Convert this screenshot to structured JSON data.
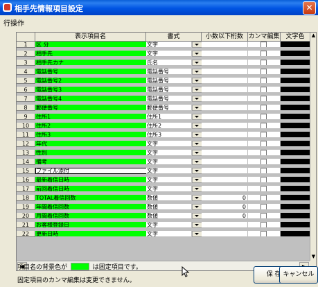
{
  "window": {
    "title": "相手先情報項目設定",
    "close_glyph": "✕"
  },
  "menu": {
    "items": [
      "行操作"
    ]
  },
  "grid": {
    "headers": {
      "row_number": "",
      "display_name": "表示項目名",
      "format": "書式",
      "decimals": "小数以下桁数",
      "comma": "カンマ編集",
      "text_color": "文字色"
    },
    "rows": [
      {
        "num": "1",
        "name": "区 分",
        "format": "文字",
        "decimals": ""
      },
      {
        "num": "2",
        "name": "相手先",
        "format": "文字",
        "decimals": ""
      },
      {
        "num": "3",
        "name": "相手先カナ",
        "format": "氏名",
        "decimals": ""
      },
      {
        "num": "4",
        "name": "電話番号",
        "format": "電話番号",
        "decimals": ""
      },
      {
        "num": "5",
        "name": "電話番号2",
        "format": "電話番号",
        "decimals": ""
      },
      {
        "num": "6",
        "name": "電話番号3",
        "format": "電話番号",
        "decimals": ""
      },
      {
        "num": "7",
        "name": "電話番号4",
        "format": "電話番号",
        "decimals": ""
      },
      {
        "num": "8",
        "name": "郵便番号",
        "format": "郵便番号",
        "decimals": ""
      },
      {
        "num": "9",
        "name": "住所1",
        "format": "住所1",
        "decimals": ""
      },
      {
        "num": "10",
        "name": "住所2",
        "format": "住所2",
        "decimals": ""
      },
      {
        "num": "11",
        "name": "住所3",
        "format": "住所3",
        "decimals": ""
      },
      {
        "num": "12",
        "name": "年代",
        "format": "文字",
        "decimals": ""
      },
      {
        "num": "13",
        "name": "性別",
        "format": "文字",
        "decimals": ""
      },
      {
        "num": "14",
        "name": "備考",
        "format": "文字",
        "decimals": ""
      },
      {
        "num": "15",
        "name": "ファイル添付",
        "format": "文字",
        "decimals": "",
        "selected": true
      },
      {
        "num": "16",
        "name": "最新着信日時",
        "format": "文字",
        "decimals": ""
      },
      {
        "num": "17",
        "name": "前回着信日時",
        "format": "文字",
        "decimals": ""
      },
      {
        "num": "18",
        "name": "TOTAL着信回数",
        "format": "数値",
        "decimals": "0"
      },
      {
        "num": "19",
        "name": "年間着信回数",
        "format": "数値",
        "decimals": "0"
      },
      {
        "num": "20",
        "name": "月間着信回数",
        "format": "数値",
        "decimals": "0"
      },
      {
        "num": "21",
        "name": "お客様登録日",
        "format": "文字",
        "decimals": ""
      },
      {
        "num": "22",
        "name": "更新日時",
        "format": "文字",
        "decimals": ""
      }
    ]
  },
  "footer": {
    "legend_before": "項目名の背景色が",
    "legend_after": "は固定項目です。",
    "note": "固定項目のカンマ編集は変更できません。",
    "save_label": "保 存",
    "cancel_label": "キャンセル"
  },
  "colors": {
    "fixed_bg": "#00ff00",
    "title_bar": "#0054e3",
    "text_color_cell": "#000000"
  }
}
